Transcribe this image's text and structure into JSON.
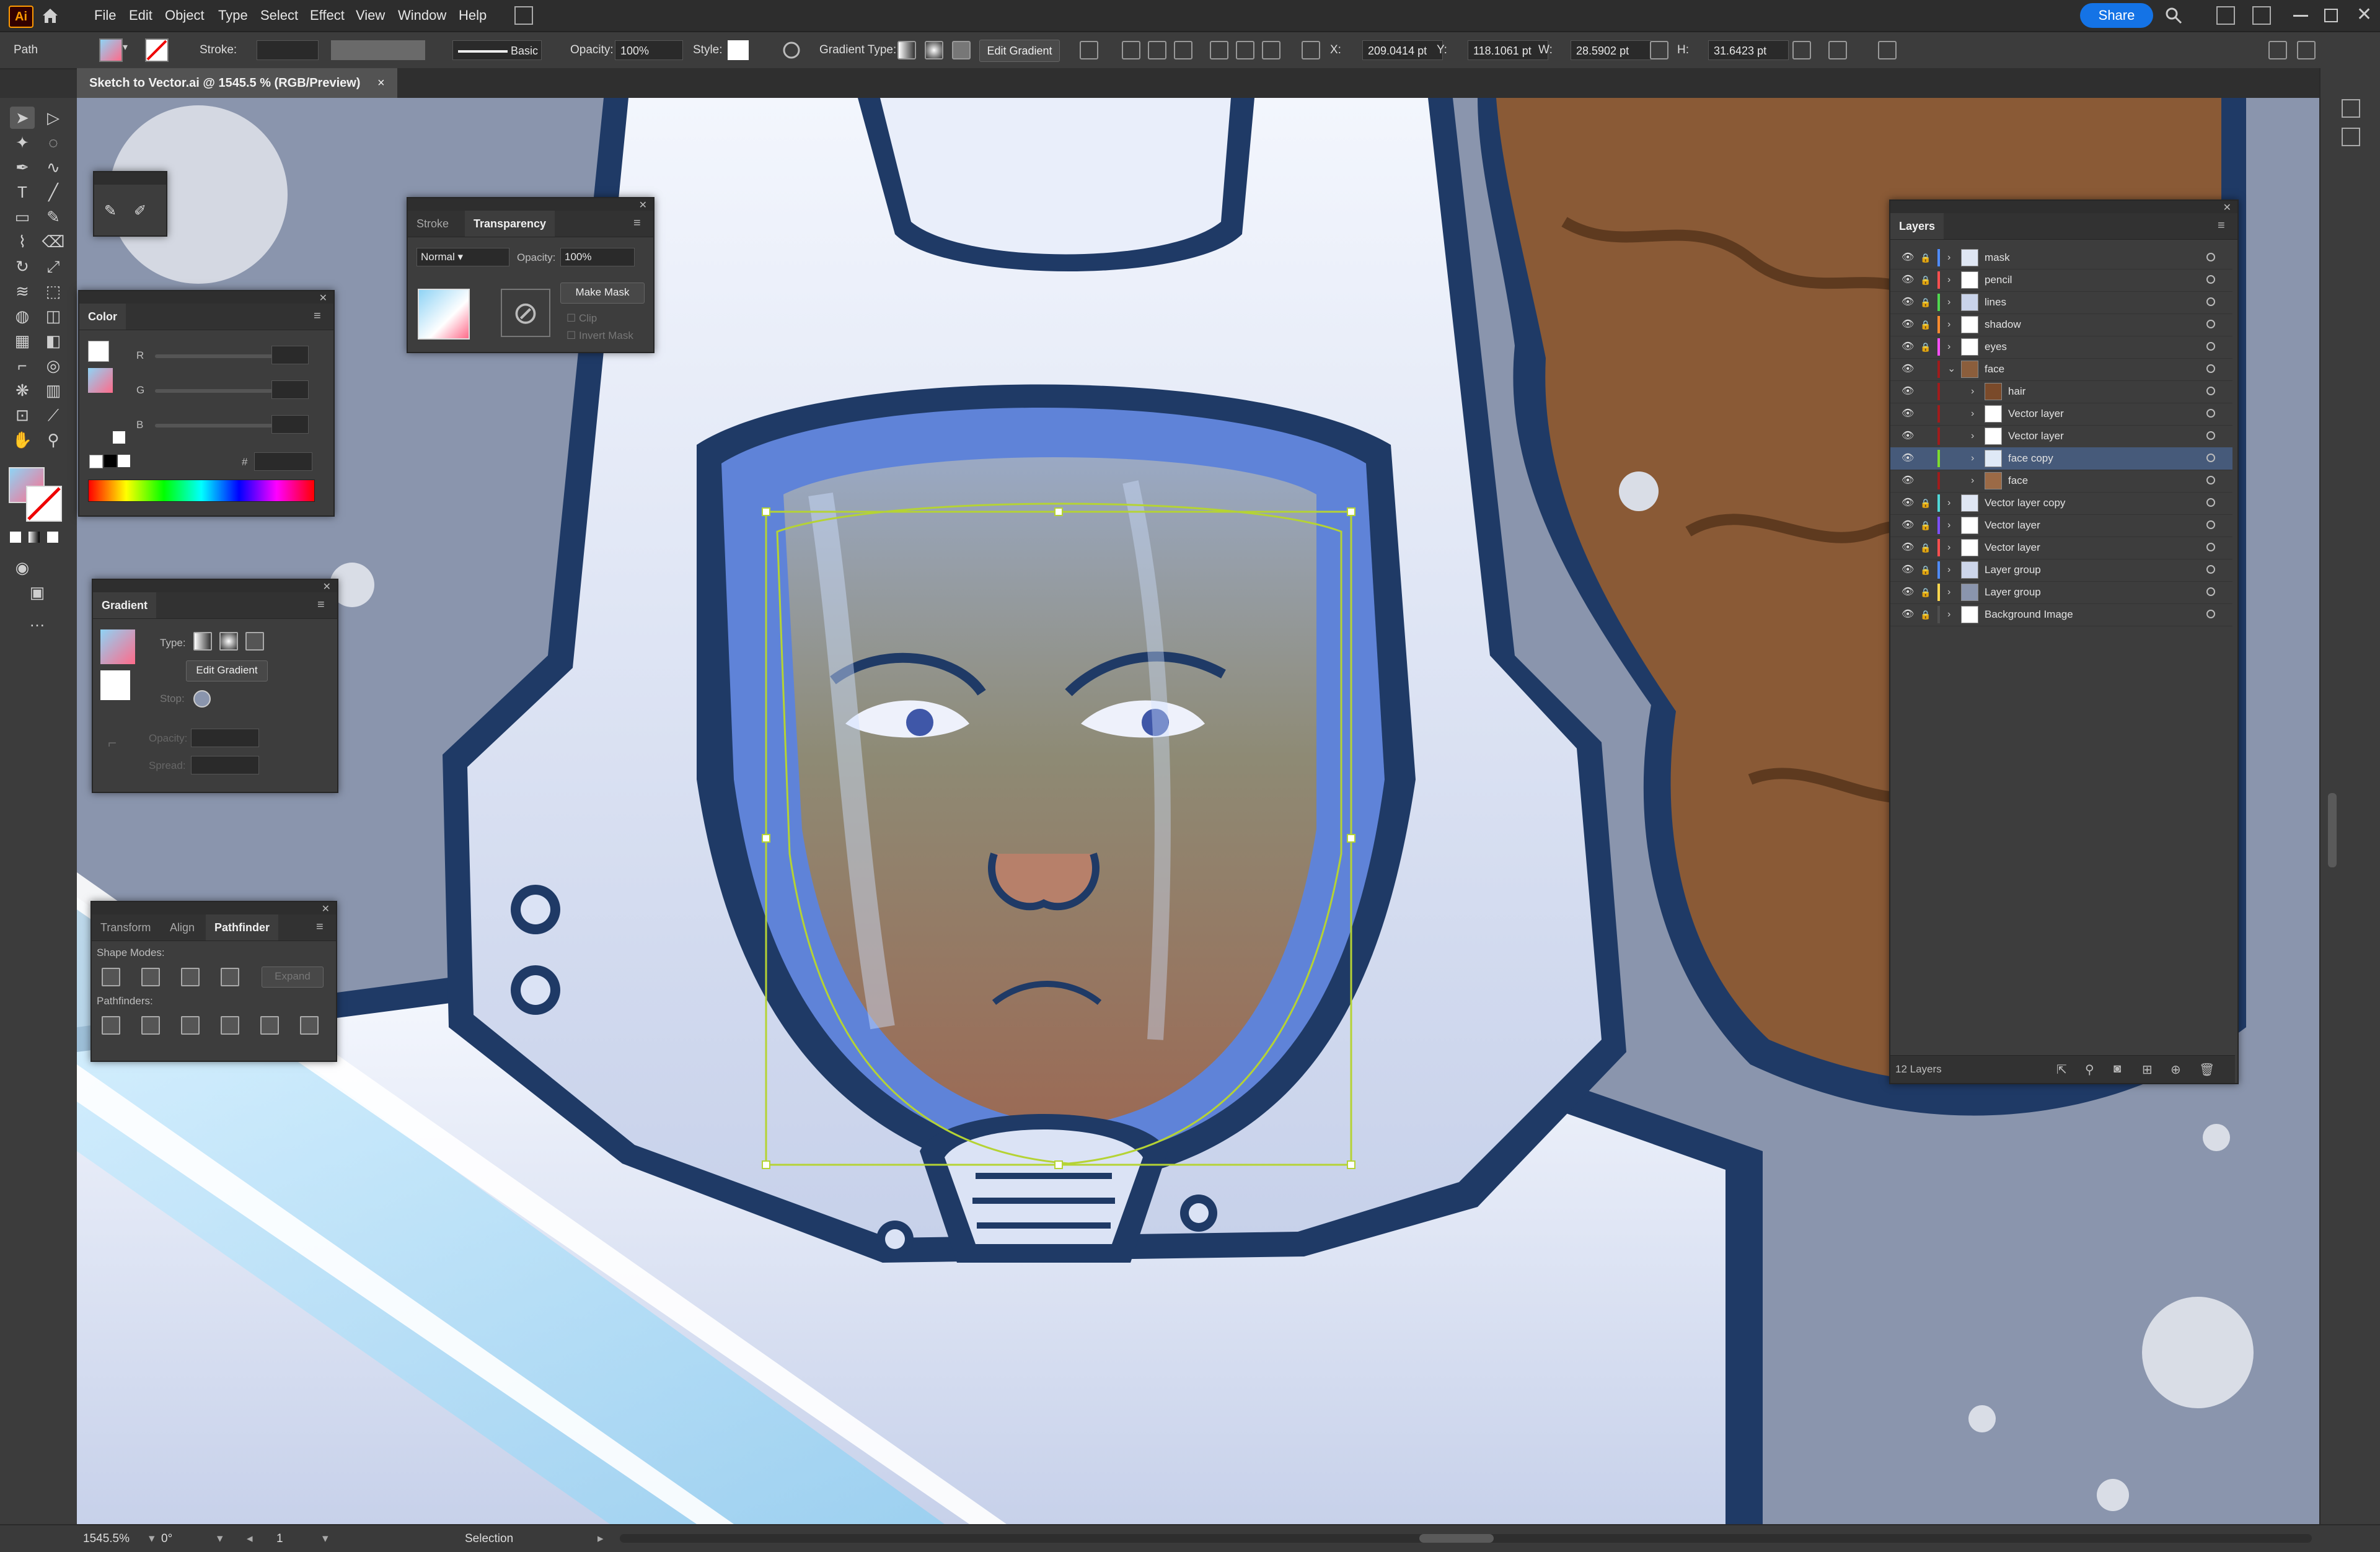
{
  "app": {
    "logo": "Ai"
  },
  "menu": [
    "File",
    "Edit",
    "Object",
    "Type",
    "Select",
    "Effect",
    "View",
    "Window",
    "Help"
  ],
  "share_label": "Share",
  "control": {
    "object_type": "Path",
    "stroke_label": "Stroke:",
    "brush_label": "Basic",
    "opacity_label": "Opacity:",
    "opacity_value": "100%",
    "style_label": "Style:",
    "gradient_type_label": "Gradient Type:",
    "edit_gradient_label": "Edit Gradient",
    "x_label": "X:",
    "x_value": "209.0414 pt",
    "y_label": "Y:",
    "y_value": "118.1061 pt",
    "w_label": "W:",
    "w_value": "28.5902 pt",
    "h_label": "H:",
    "h_value": "31.6423 pt"
  },
  "document_tab": {
    "title": "Sketch to Vector.ai @ 1545.5 % (RGB/Preview)",
    "close": "×"
  },
  "color_panel": {
    "title": "Color",
    "channels": [
      "R",
      "G",
      "B"
    ],
    "hex_prefix": "#"
  },
  "transparency_panel": {
    "tabs": [
      "Stroke",
      "Transparency"
    ],
    "blend_mode": "Normal",
    "opacity_label": "Opacity:",
    "opacity_value": "100%",
    "make_mask_label": "Make Mask",
    "clip_label": "Clip",
    "invert_mask_label": "Invert Mask"
  },
  "gradient_panel": {
    "title": "Gradient",
    "type_label": "Type:",
    "edit_gradient_label": "Edit Gradient",
    "stop_label": "Stop:",
    "opacity_label": "Opacity:",
    "spread_label": "Spread:"
  },
  "pathfinder_panel": {
    "tabs": [
      "Transform",
      "Align",
      "Pathfinder"
    ],
    "shape_modes_label": "Shape Modes:",
    "expand_label": "Expand",
    "pathfinders_label": "Pathfinders:"
  },
  "layers_panel": {
    "title": "Layers",
    "count_label": "12 Layers",
    "rows": [
      {
        "name": "mask",
        "color": "#4f8cff",
        "indent": 0,
        "locked": true,
        "thumb": "#dfe6f3"
      },
      {
        "name": "pencil",
        "color": "#ff4f4f",
        "indent": 0,
        "locked": true,
        "thumb": "#ffffff"
      },
      {
        "name": "lines",
        "color": "#4fd84f",
        "indent": 0,
        "locked": true,
        "thumb": "#c9d3ea"
      },
      {
        "name": "shadow",
        "color": "#ff8c2e",
        "indent": 0,
        "locked": true,
        "thumb": "#ffffff"
      },
      {
        "name": "eyes",
        "color": "#ff4fff",
        "indent": 0,
        "locked": true,
        "thumb": "#ffffff"
      },
      {
        "name": "face",
        "color": "#a01c1c",
        "indent": 0,
        "locked": false,
        "thumb": "#8b5e3c",
        "expanded": true
      },
      {
        "name": "hair",
        "color": "#a01c1c",
        "indent": 1,
        "locked": false,
        "thumb": "#7a4a2a"
      },
      {
        "name": "Vector layer",
        "color": "#a01c1c",
        "indent": 1,
        "locked": false,
        "thumb": "#ffffff"
      },
      {
        "name": "Vector layer",
        "color": "#a01c1c",
        "indent": 1,
        "locked": false,
        "thumb": "#ffffff"
      },
      {
        "name": "face copy",
        "color": "#7ddc2e",
        "indent": 1,
        "locked": false,
        "thumb": "#dfe9f6",
        "selected": true
      },
      {
        "name": "face",
        "color": "#a01c1c",
        "indent": 1,
        "locked": false,
        "thumb": "#9b6a46"
      },
      {
        "name": "Vector layer copy",
        "color": "#4fd8d8",
        "indent": 0,
        "locked": true,
        "thumb": "#dfe6f3"
      },
      {
        "name": "Vector layer",
        "color": "#7d4fff",
        "indent": 0,
        "locked": true,
        "thumb": "#ffffff"
      },
      {
        "name": "Vector layer",
        "color": "#ff4f4f",
        "indent": 0,
        "locked": true,
        "thumb": "#ffffff"
      },
      {
        "name": "Layer group",
        "color": "#4f8cff",
        "indent": 0,
        "locked": true,
        "thumb": "#cdd6ea"
      },
      {
        "name": "Layer group",
        "color": "#ffd84f",
        "indent": 0,
        "locked": true,
        "thumb": "#8a95ad"
      },
      {
        "name": "Background Image",
        "color": "#4f4f4f",
        "indent": 0,
        "locked": true,
        "thumb": "#ffffff"
      }
    ]
  },
  "status": {
    "zoom": "1545.5%",
    "rotation": "0°",
    "artboard": "1",
    "tool": "Selection"
  },
  "colors": {
    "accent": "#1473e6",
    "canvas_bg": "#8a95ad",
    "suit_outline": "#1f3a66",
    "hair": "#8a5a36",
    "selection": "#b5d334"
  }
}
